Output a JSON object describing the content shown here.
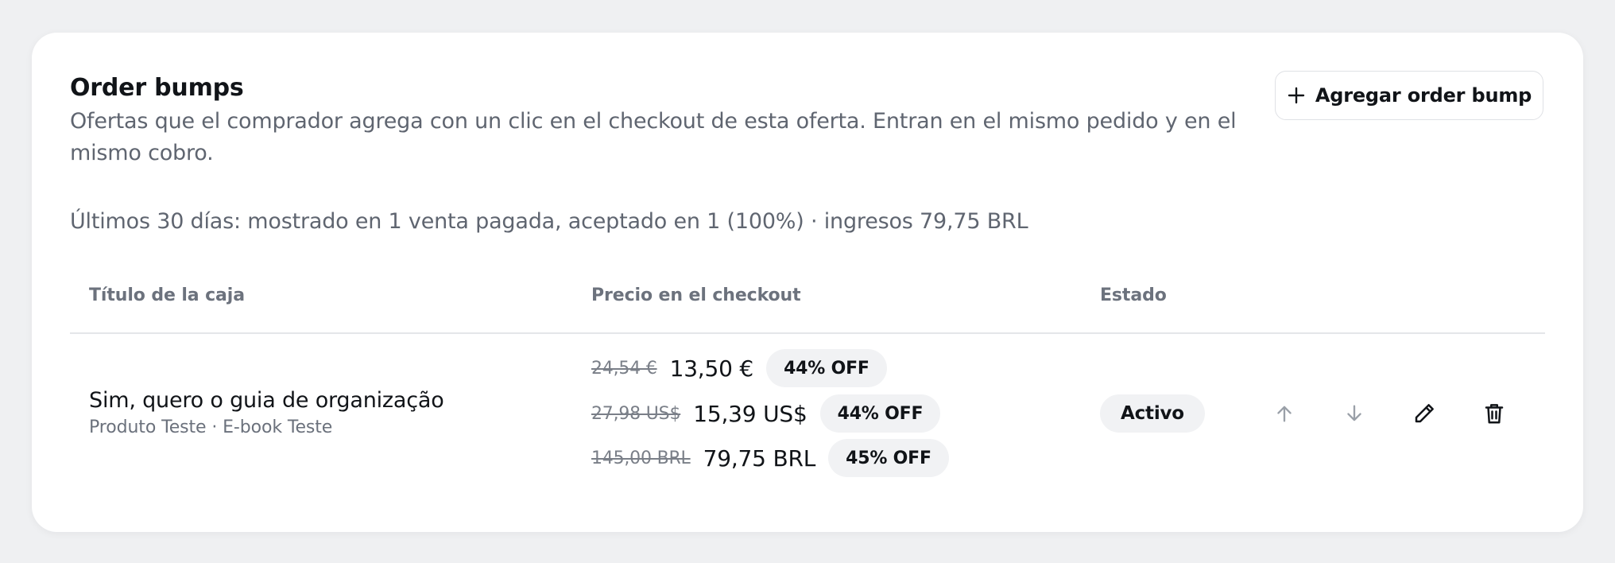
{
  "section": {
    "title": "Order bumps",
    "description": "Ofertas que el comprador agrega con un clic en el checkout de esta oferta. Entran en el mismo pedido y en el mismo cobro.",
    "stats": "Últimos 30 días: mostrado en 1 venta pagada, aceptado en 1 (100%) · ingresos 79,75 BRL",
    "add_button_label": "Agregar order bump"
  },
  "table": {
    "headers": {
      "title": "Título de la caja",
      "price": "Precio en el checkout",
      "status": "Estado"
    },
    "rows": [
      {
        "title": "Sim, quero o guia de organização",
        "subtitle": "Produto Teste · E-book Teste",
        "prices": [
          {
            "old": "24,54 €",
            "new": "13,50 €",
            "discount": "44% OFF"
          },
          {
            "old": "27,98 US$",
            "new": "15,39 US$",
            "discount": "44% OFF"
          },
          {
            "old": "145,00 BRL",
            "new": "79,75 BRL",
            "discount": "45% OFF"
          }
        ],
        "status": "Activo",
        "actions": [
          "arrow-up-icon",
          "arrow-down-icon",
          "pencil-icon",
          "trash-icon"
        ]
      }
    ]
  },
  "colors": {
    "page_background": "#eff0f2",
    "card_background": "#ffffff",
    "text_primary": "#111418",
    "text_secondary": "#5f6570",
    "badge_background": "#f1f2f4",
    "muted_icon": "#9aa0a8"
  }
}
